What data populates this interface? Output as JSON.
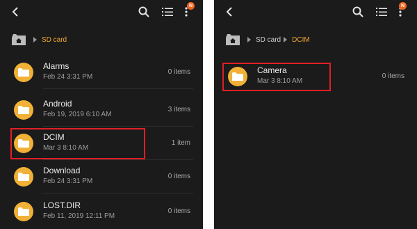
{
  "left": {
    "badge": "N",
    "breadcrumb": [
      "SD card"
    ],
    "items": [
      {
        "name": "Alarms",
        "date": "Feb 24 3:31 PM",
        "count": "0 items"
      },
      {
        "name": "Android",
        "date": "Feb 19, 2019 6:10 AM",
        "count": "3 items"
      },
      {
        "name": "DCIM",
        "date": "Mar 3 8:10 AM",
        "count": "1 item"
      },
      {
        "name": "Download",
        "date": "Feb 24 3:31 PM",
        "count": "0 items"
      },
      {
        "name": "LOST.DIR",
        "date": "Feb 11, 2019 12:11 PM",
        "count": "0 items"
      }
    ]
  },
  "right": {
    "badge": "N",
    "breadcrumb": [
      "SD card",
      "DCIM"
    ],
    "items": [
      {
        "name": "Camera",
        "date": "Mar 3 8:10 AM",
        "count": "0 items"
      }
    ]
  },
  "colors": {
    "background": "#1b1b1b",
    "folder": "#f1b136",
    "active_crumb": "#f0a92c",
    "badge": "#f0641e",
    "highlight": "#e01f26"
  }
}
